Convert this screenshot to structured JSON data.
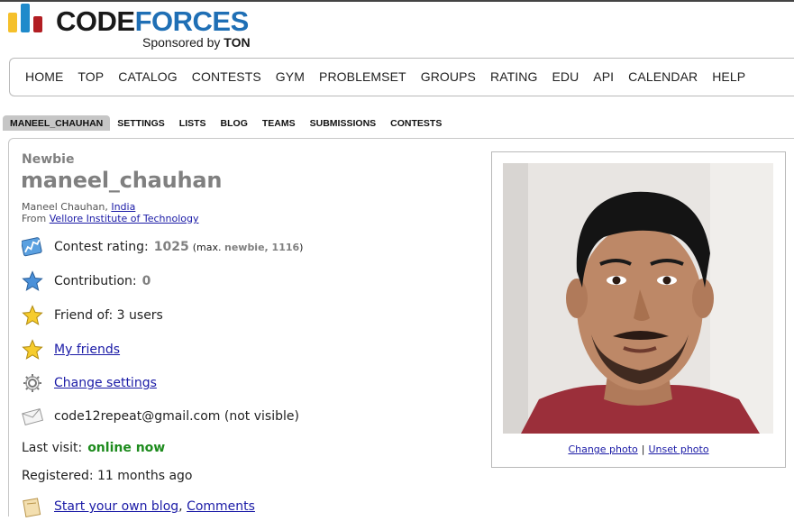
{
  "logo": {
    "word_code": "CODE",
    "word_forces": "FORCES",
    "sponsor_prefix": "Sponsored by",
    "sponsor_name": "TON"
  },
  "main_menu": [
    "HOME",
    "TOP",
    "CATALOG",
    "CONTESTS",
    "GYM",
    "PROBLEMSET",
    "GROUPS",
    "RATING",
    "EDU",
    "API",
    "CALENDAR",
    "HELP"
  ],
  "sub_menu": {
    "active": "MANEEL_CHAUHAN",
    "items": [
      "SETTINGS",
      "LISTS",
      "BLOG",
      "TEAMS",
      "SUBMISSIONS",
      "CONTESTS"
    ]
  },
  "profile": {
    "rank": "Newbie",
    "handle": "maneel_chauhan",
    "full_name": "Maneel Chauhan,",
    "country": "India",
    "from_label": "From",
    "organization": "Vellore Institute of Technology",
    "rating_label": "Contest rating:",
    "rating_value": "1025",
    "rating_max_prefix": "(max.",
    "rating_max_rank_value": "newbie, 1116",
    "rating_max_suffix": ")",
    "contribution_label": "Contribution:",
    "contribution_value": "0",
    "friend_of": "Friend of: 3 users",
    "my_friends": "My friends",
    "change_settings": "Change settings",
    "email": "code12repeat@gmail.com (not visible)",
    "last_visit_label": "Last visit:",
    "last_visit_value": "online now",
    "registered": "Registered: 11 months ago",
    "blog_link": "Start your own blog",
    "comments_link": "Comments"
  },
  "photo": {
    "change": "Change photo",
    "separator": "|",
    "unset": "Unset photo"
  },
  "colors": {
    "newbie_gray": "#808080",
    "link_blue": "#1a1aa6",
    "online_green": "#1d8b1d",
    "logo_yellow": "#f5c02b",
    "logo_blue": "#1f8acb",
    "logo_red": "#b21e23"
  }
}
